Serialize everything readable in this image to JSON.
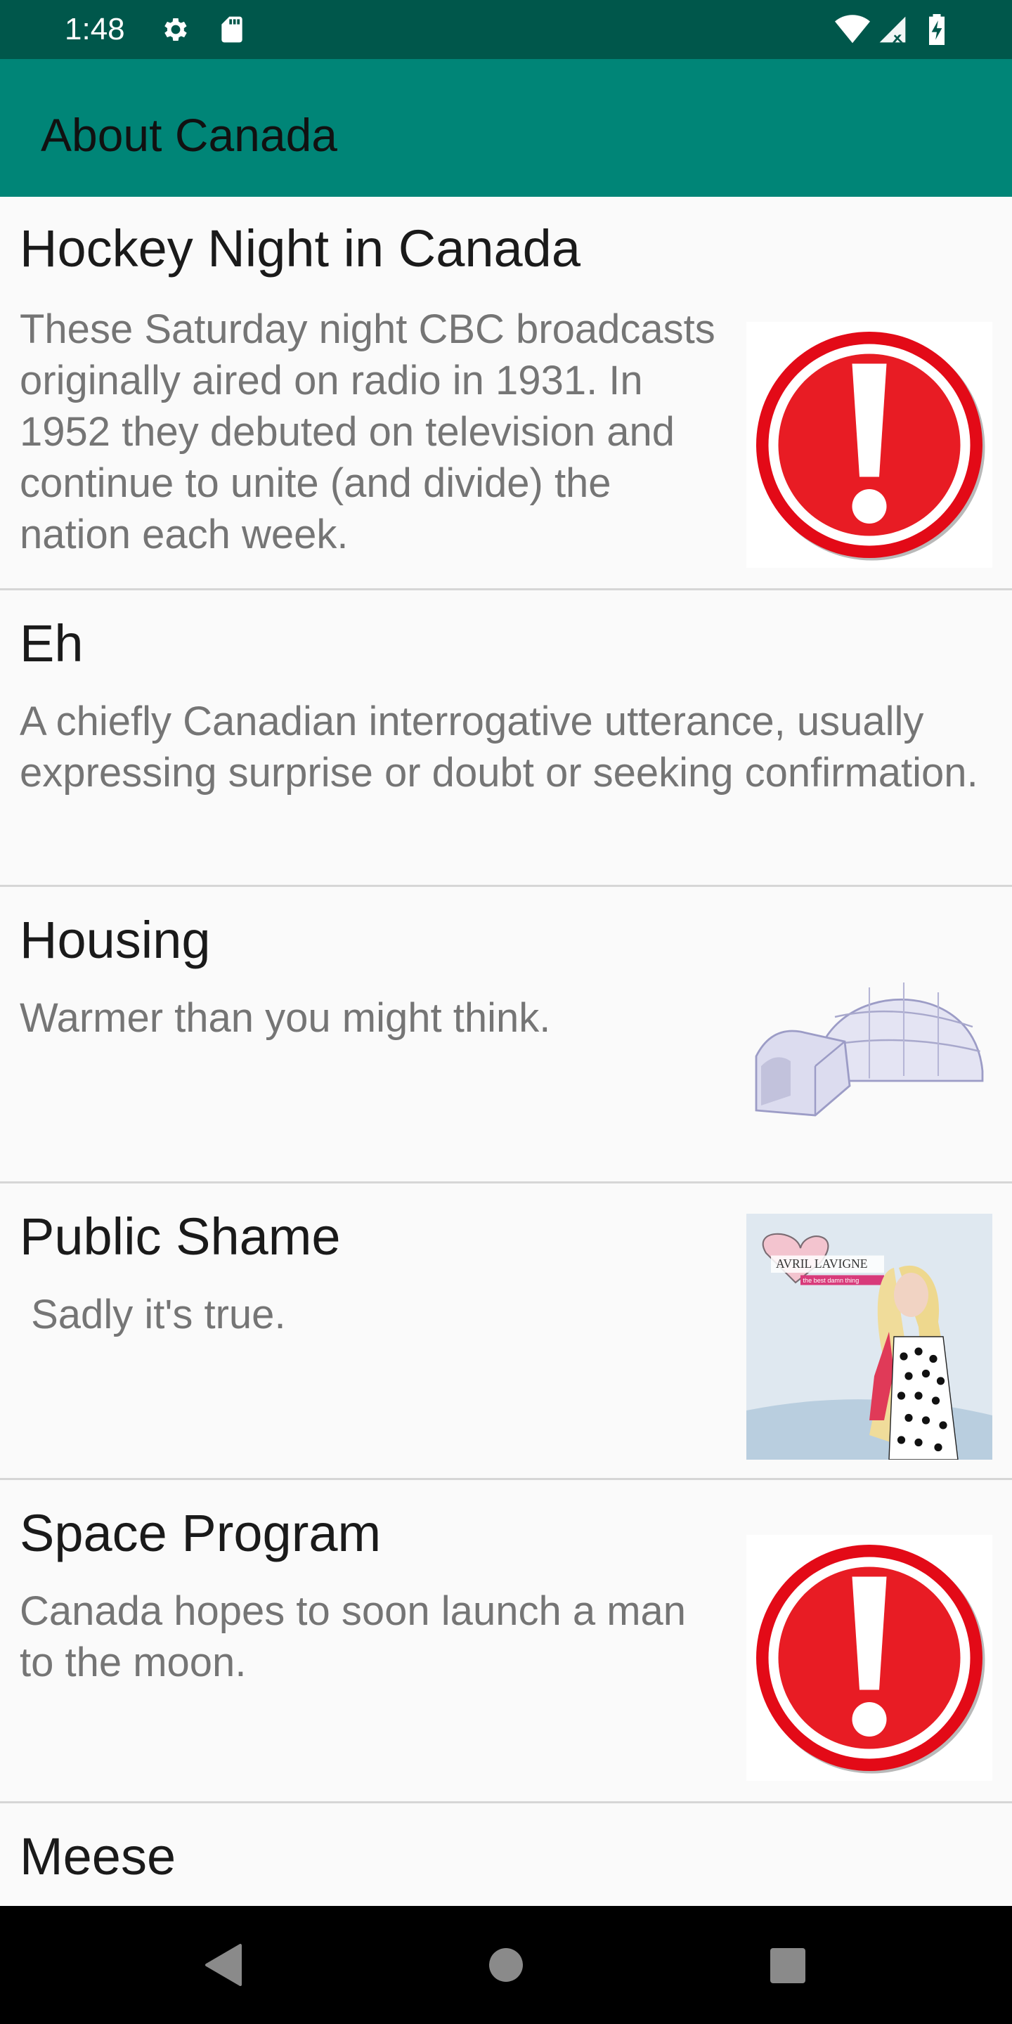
{
  "status_bar": {
    "time": "1:48",
    "icons": [
      "gear-icon",
      "sd-card-icon",
      "wifi-icon",
      "signal-icon",
      "battery-charging-icon"
    ]
  },
  "app_bar": {
    "title": "About Canada",
    "color": "#008577",
    "status_color": "#00574b"
  },
  "items": [
    {
      "title": "Hockey Night in Canada",
      "description": "These Saturday night CBC broadcasts originally aired on radio in 1931. In 1952 they debuted on television and continue to unite (and divide) the nation each week.",
      "image": "alert-icon"
    },
    {
      "title": "Eh",
      "description": "A chiefly Canadian interrogative utterance, usually expressing surprise or doubt or seeking confirmation.",
      "image": ""
    },
    {
      "title": "Housing",
      "description": "Warmer than you might think.",
      "image": "igloo-icon"
    },
    {
      "title": "Public Shame",
      "description": " Sadly it's true.",
      "image": "album-cover-image",
      "image_caption": "AVRIL LAVIGNE",
      "image_subcaption": "the best damn thing"
    },
    {
      "title": "Space Program",
      "description": "Canada hopes to soon launch a man to the moon.",
      "image": "alert-icon"
    },
    {
      "title": "Meese",
      "description": "",
      "image": ""
    }
  ],
  "nav_bar": {
    "buttons": [
      "back-icon",
      "home-icon",
      "recents-icon"
    ]
  }
}
